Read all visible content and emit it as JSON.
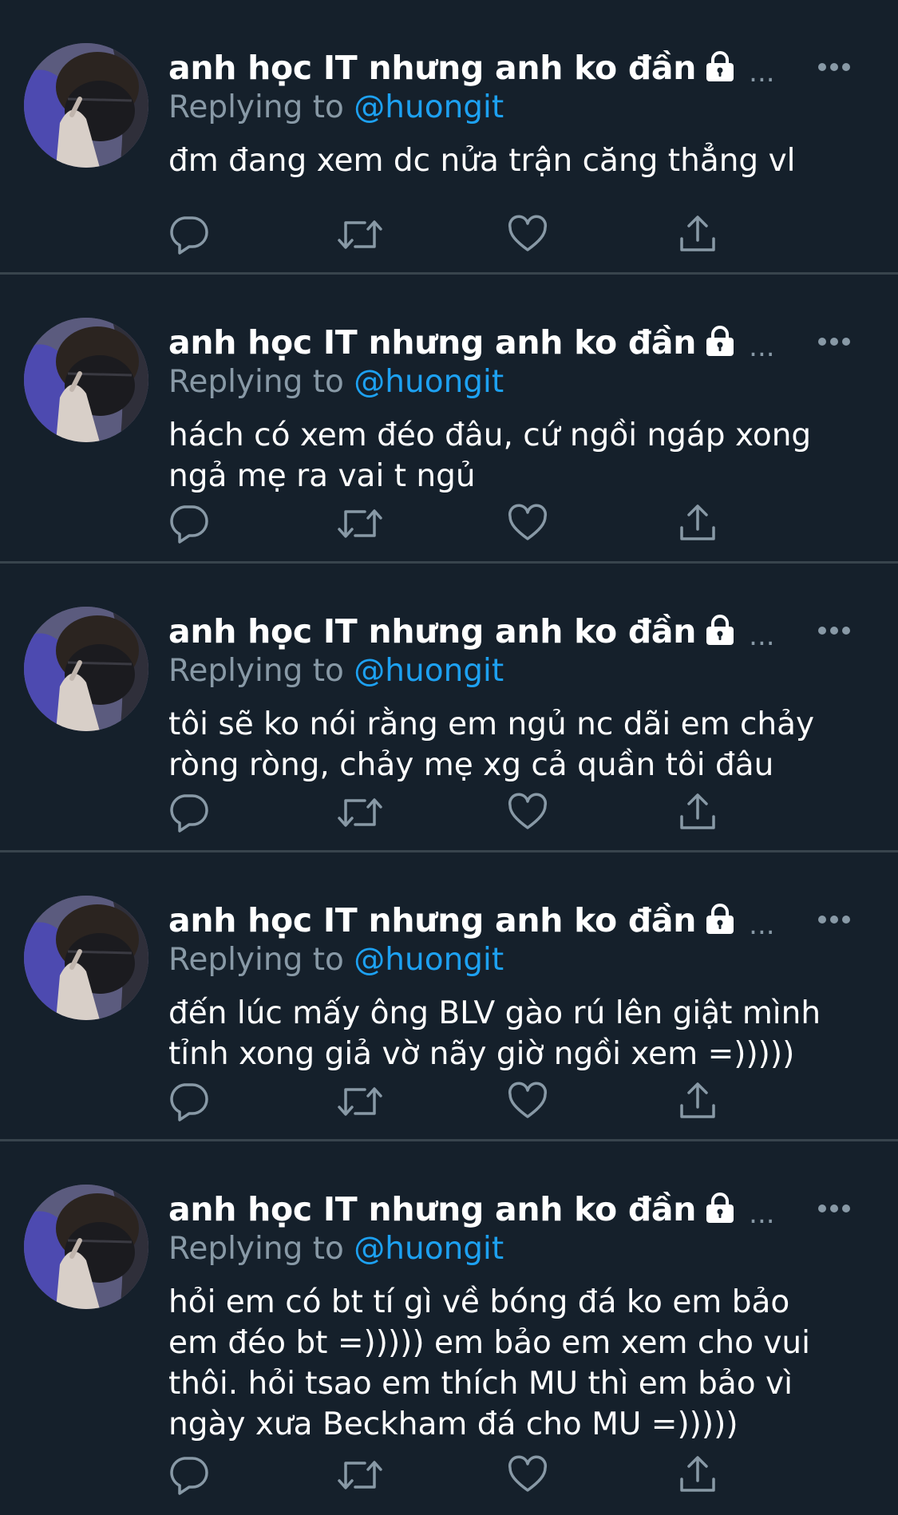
{
  "colors": {
    "background": "#15202b",
    "divider": "#38444d",
    "text": "#ffffff",
    "secondary": "#8899a6",
    "accent": "#1da1f2"
  },
  "icons": {
    "verified_lock": "lock-icon",
    "more": "more-horizontal-icon",
    "reply": "reply-icon",
    "retweet": "retweet-icon",
    "like": "heart-icon",
    "share": "share-icon"
  },
  "tweets": [
    {
      "name": "anh học IT nhưng anh ko đần",
      "ellipsis": "...",
      "replying_prefix": "Replying to",
      "replying_handle": "@huongit",
      "text": "đm đang xem dc nửa trận căng thẳng vl"
    },
    {
      "name": "anh học IT nhưng anh ko đần",
      "ellipsis": "...",
      "replying_prefix": "Replying to",
      "replying_handle": "@huongit",
      "text": "hách có xem đéo đâu, cứ ngồi ngáp xong\nngả mẹ ra vai t ngủ"
    },
    {
      "name": "anh học IT nhưng anh ko đần",
      "ellipsis": "...",
      "replying_prefix": "Replying to",
      "replying_handle": "@huongit",
      "text": "tôi sẽ ko nói rằng em ngủ nc dãi em chảy\nròng ròng, chảy mẹ xg cả quần tôi đâu"
    },
    {
      "name": "anh học IT nhưng anh ko đần",
      "ellipsis": "...",
      "replying_prefix": "Replying to",
      "replying_handle": "@huongit",
      "text": "đến lúc mấy ông BLV gào rú lên giật mình\ntỉnh xong giả vờ nãy giờ ngồi xem =)))))"
    },
    {
      "name": "anh học IT nhưng anh ko đần",
      "ellipsis": "...",
      "replying_prefix": "Replying to",
      "replying_handle": "@huongit",
      "text": "hỏi em có bt tí gì về bóng đá ko em bảo\nem đéo bt =))))) em bảo em xem cho vui\nthôi. hỏi tsao em thích MU thì em bảo vì\nngày xưa Beckham đá cho MU =)))))"
    }
  ]
}
